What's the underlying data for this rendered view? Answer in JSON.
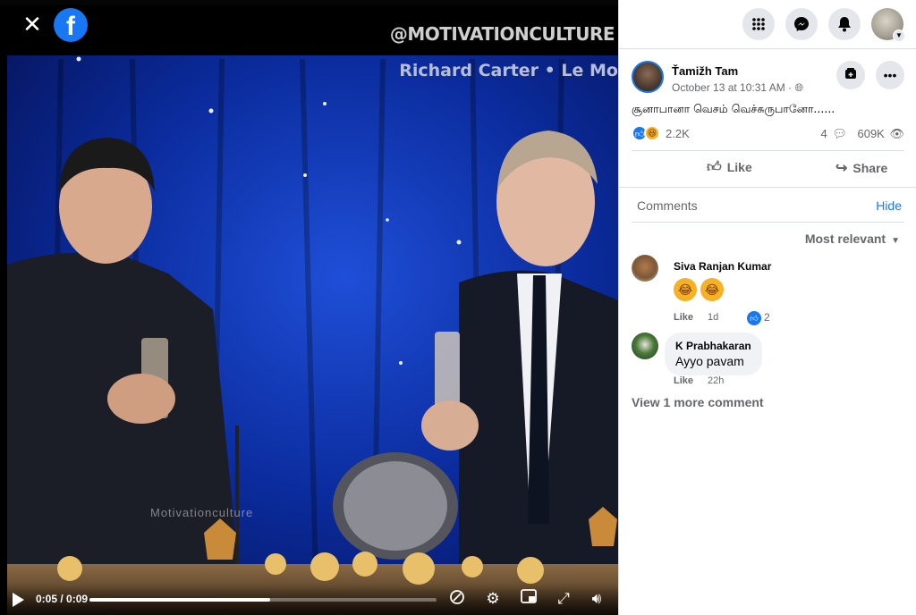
{
  "video": {
    "watermark_handle": "@MOTIVATIONCULTURE",
    "watermark_credit": "Richard Carter • Le Mo",
    "watermark_small": "Motivationculture",
    "time": "0:05 / 0:09",
    "progress": 0.52
  },
  "icons": {
    "close": "close-icon",
    "facebook_logo": "f",
    "menu": "menu-grid-icon",
    "messenger": "messenger-icon",
    "notifications": "bell-icon"
  },
  "post": {
    "author": "Ťamižh Tam",
    "timestamp": "October 13 at 10:31 AM",
    "visibility_icon": "globe-icon",
    "text": "சூனாபானா வெசம் வெச்சுருபானோ......",
    "reaction_count": "2.2K",
    "comment_count": "4",
    "view_count": "609K",
    "like_label": "Like",
    "share_label": "Share"
  },
  "comments": {
    "header": "Comments",
    "hide_label": "Hide",
    "sort_label": "Most relevant",
    "items": [
      {
        "name": "Siva Ranjan Kumar",
        "text": "🤣🤣",
        "like_label": "Like",
        "age": "1d",
        "likes": "2"
      },
      {
        "name": "K Prabhakaran",
        "text": "Ayyo pavam",
        "like_label": "Like",
        "age": "22h"
      }
    ],
    "more_label": "View 1 more comment"
  },
  "colors": {
    "brand_blue": "#1877f2",
    "stage_blue": "#0a2a9a"
  }
}
